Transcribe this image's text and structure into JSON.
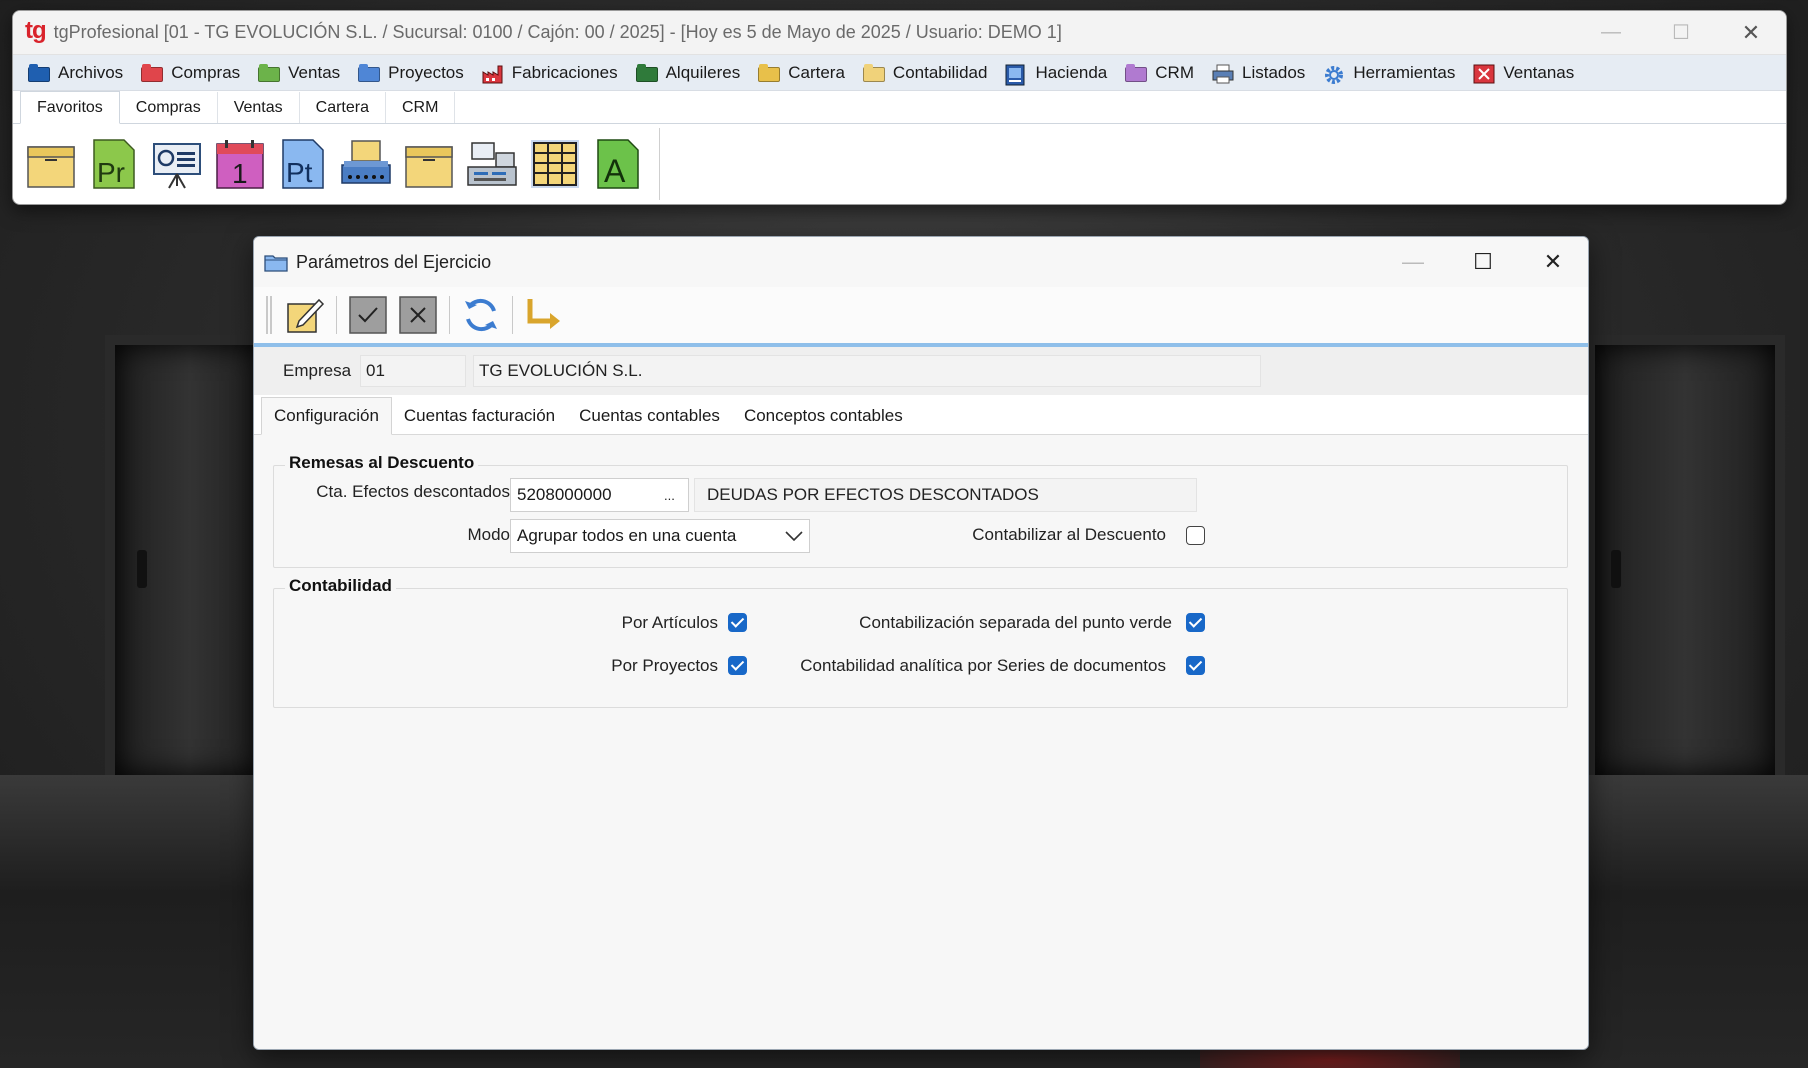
{
  "main_window": {
    "logo": "tg",
    "title": "tgProfesional [01 - TG EVOLUCIÓN S.L. / Sucursal: 0100 / Cajón: 00 / 2025] - [Hoy es 5 de Mayo de 2025 / Usuario: DEMO 1]",
    "controls": {
      "minimize": "—",
      "maximize": "☐",
      "close": "✕"
    }
  },
  "menubar": {
    "items": [
      {
        "label": "Archivos",
        "icon": "folder-icon",
        "color": "#1f5fb0"
      },
      {
        "label": "Compras",
        "icon": "folder-icon",
        "color": "#e0454b"
      },
      {
        "label": "Ventas",
        "icon": "folder-icon",
        "color": "#6cb34a"
      },
      {
        "label": "Proyectos",
        "icon": "folder-icon",
        "color": "#4f86d6"
      },
      {
        "label": "Fabricaciones",
        "icon": "factory-icon",
        "color": "#d9363e"
      },
      {
        "label": "Alquileres",
        "icon": "folder-icon",
        "color": "#2f7a3a"
      },
      {
        "label": "Cartera",
        "icon": "folder-icon",
        "color": "#e8c04a"
      },
      {
        "label": "Contabilidad",
        "icon": "folder-icon",
        "color": "#f0d27a"
      },
      {
        "label": "Hacienda",
        "icon": "hacienda-icon",
        "color": "#2a5aa8"
      },
      {
        "label": "CRM",
        "icon": "folder-icon",
        "color": "#b07ad0"
      },
      {
        "label": "Listados",
        "icon": "printer-icon",
        "color": "#5a7fb5"
      },
      {
        "label": "Herramientas",
        "icon": "gear-icon",
        "color": "#3c7cd0"
      },
      {
        "label": "Ventanas",
        "icon": "windows-close-icon",
        "color": "#d9363e"
      }
    ]
  },
  "ribbon": {
    "tabs": [
      "Favoritos",
      "Compras",
      "Ventas",
      "Cartera",
      "CRM"
    ],
    "active_tab": "Favoritos",
    "tools": [
      {
        "name": "box-icon",
        "glyph": ""
      },
      {
        "name": "document-pr-icon",
        "glyph": "Pr"
      },
      {
        "name": "presentation-icon",
        "glyph": ""
      },
      {
        "name": "calendar-icon",
        "glyph": "1"
      },
      {
        "name": "document-pt-icon",
        "glyph": "Pt"
      },
      {
        "name": "printer-terminal-icon",
        "glyph": ""
      },
      {
        "name": "box-icon",
        "glyph": ""
      },
      {
        "name": "cash-register-icon",
        "glyph": ""
      },
      {
        "name": "spreadsheet-icon",
        "glyph": ""
      },
      {
        "name": "document-a-icon",
        "glyph": "A"
      }
    ]
  },
  "dialog": {
    "title": "Parámetros del Ejercicio",
    "controls": {
      "minimize": "—",
      "maximize": "☐",
      "close": "✕"
    },
    "empresa": {
      "label": "Empresa",
      "code": "01",
      "name": "TG EVOLUCIÓN S.L."
    },
    "tabs": [
      "Configuración",
      "Cuentas facturación",
      "Cuentas contables",
      "Conceptos contables"
    ],
    "active_tab": "Configuración",
    "remesas": {
      "title": "Remesas al Descuento",
      "cta_label": "Cta. Efectos descontados",
      "cta_value": "5208000000",
      "cta_browse": "...",
      "cta_description": "DEUDAS POR EFECTOS DESCONTADOS",
      "modo_label": "Modo",
      "modo_value": "Agrupar todos en una cuenta",
      "contabilizar_label": "Contabilizar al Descuento",
      "contabilizar_checked": false
    },
    "contabilidad": {
      "title": "Contabilidad",
      "por_articulos_label": "Por Artículos",
      "por_articulos_checked": true,
      "por_proyectos_label": "Por Proyectos",
      "por_proyectos_checked": true,
      "punto_verde_label": "Contabilización separada del punto verde",
      "punto_verde_checked": true,
      "series_label": "Contabilidad analítica por Series de documentos",
      "series_checked": true
    }
  },
  "colors": {
    "accent": "#1868c8",
    "toolbar_underline": "#8fbfea",
    "logo": "#d9232b"
  }
}
